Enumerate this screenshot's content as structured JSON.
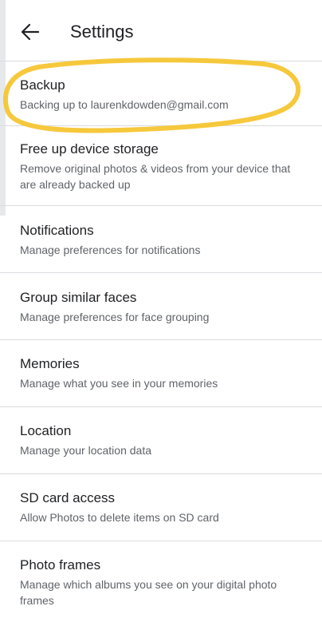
{
  "header": {
    "title": "Settings"
  },
  "icons": {
    "back": "arrow-back-icon"
  },
  "colors": {
    "highlight": "#f6c531",
    "divider": "#dadce0"
  },
  "settings": [
    {
      "title": "Backup",
      "subtitle": "Backing up to laurenkdowden@gmail.com"
    },
    {
      "title": "Free up device storage",
      "subtitle": "Remove original photos & videos from your device that are already backed up"
    },
    {
      "title": "Notifications",
      "subtitle": "Manage preferences for notifications"
    },
    {
      "title": "Group similar faces",
      "subtitle": "Manage preferences for face grouping"
    },
    {
      "title": "Memories",
      "subtitle": "Manage what you see in your memories"
    },
    {
      "title": "Location",
      "subtitle": "Manage your location data"
    },
    {
      "title": "SD card access",
      "subtitle": "Allow Photos to delete items on SD card"
    },
    {
      "title": "Photo frames",
      "subtitle": "Manage which albums you see on your digital photo frames"
    }
  ]
}
